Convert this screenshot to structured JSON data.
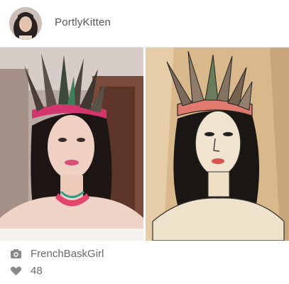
{
  "header": {
    "username": "PortlyKitten"
  },
  "post": {
    "left_image": "original-photo",
    "right_image": "drawing"
  },
  "footer": {
    "artist": "FrenchBaskGirl",
    "artist_icon": "camera-icon",
    "likes": "48",
    "likes_icon": "heart-icon"
  },
  "colors": {
    "text": "#6a6a6a",
    "icon": "#8a8a8a",
    "divider": "#e6e6e6"
  }
}
